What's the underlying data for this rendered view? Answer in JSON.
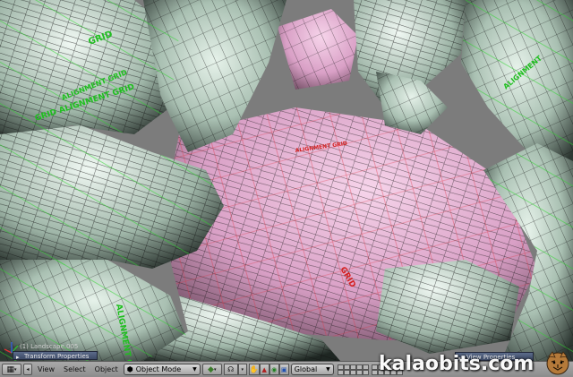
{
  "viewport": {
    "mesh_texture_text": [
      "GRID ALIGNMENT GRID",
      "ALIGNMENT GRID",
      "GRID",
      "ALIGNMENT",
      "ALIGNMENT GRID",
      "GRID",
      "ALIGNMENT GRID"
    ],
    "overlay_label": "(1) Landscape.005",
    "panels": {
      "transform": "Transform Properties",
      "view": "View Properties"
    }
  },
  "header": {
    "menus": [
      "View",
      "Select",
      "Object"
    ],
    "mode_select": "Object Mode",
    "orientation_select": "Global"
  },
  "watermark": "kalaobits.com",
  "colors": {
    "rock": "#c9ddd0",
    "rock_shadow": "#2f3a35",
    "pink": "#e8b4d8",
    "wire": "#101010",
    "text_green": "#1fbf1f",
    "text_red": "#d42020"
  }
}
